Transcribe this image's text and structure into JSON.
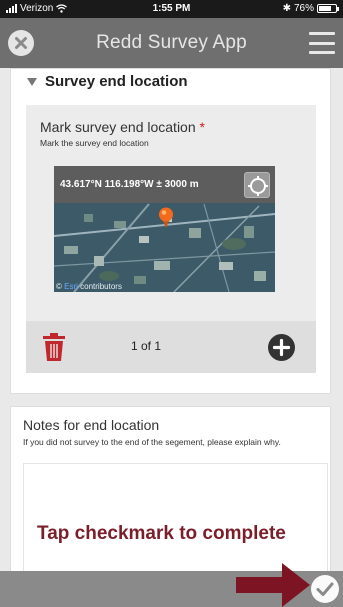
{
  "status_bar": {
    "carrier": "Verizon",
    "time": "1:55 PM",
    "battery_percent": "76%",
    "battery_level": 0.76
  },
  "header": {
    "title": "Redd Survey App"
  },
  "group": {
    "title": "Survey end location"
  },
  "question": {
    "label": "Mark survey end location",
    "required_marker": "*",
    "hint": "Mark the survey end location"
  },
  "map": {
    "coordinates": "43.617°N 116.198°W ± 3000 m",
    "attribution_brand": "Esri",
    "attribution_rest": "contributors"
  },
  "pager": {
    "page_text": "1 of 1"
  },
  "notes": {
    "label": "Notes for end location",
    "hint": "If you did not survey to the end of the segement, please explain why.",
    "value": ""
  },
  "instruction": {
    "text": "Tap checkmark to complete"
  },
  "colors": {
    "header_bg": "#6f6f6f",
    "required": "#d21d1d",
    "trash": "#c0282d",
    "pin": "#f26a1c",
    "instruction": "#7a1f2a",
    "arrow": "#7d1424"
  },
  "icons": {
    "close": "close-icon",
    "menu": "hamburger-menu-icon",
    "caret": "caret-down-icon",
    "locate": "locate-crosshair-icon",
    "pin": "map-pin-icon",
    "trash": "trash-icon",
    "add": "plus-circle-icon",
    "arrow": "arrow-right-icon",
    "submit": "checkmark-icon"
  }
}
